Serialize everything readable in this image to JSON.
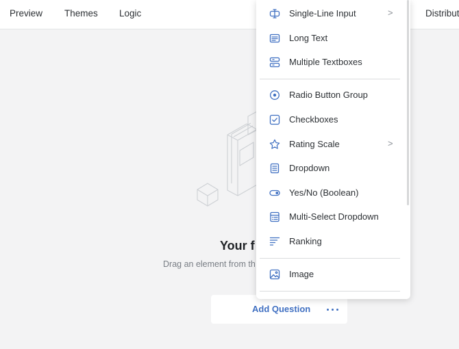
{
  "topbar": {
    "preview": "Preview",
    "themes": "Themes",
    "logic": "Logic",
    "distribute": "Distribut"
  },
  "empty": {
    "title": "Your f",
    "subtitle": "Drag an element from th"
  },
  "add_bar": {
    "add_label": "Add Question",
    "more_icon": "more-horizontal-icon"
  },
  "menu": {
    "accent_color": "#3f6fc1",
    "items": [
      {
        "label": "Single-Line Input",
        "icon": "single-line-input-icon",
        "submenu": ">"
      },
      {
        "label": "Long Text",
        "icon": "long-text-icon"
      },
      {
        "label": "Multiple Textboxes",
        "icon": "multiple-textboxes-icon"
      },
      {
        "label": "Radio Button Group",
        "icon": "radio-button-icon"
      },
      {
        "label": "Checkboxes",
        "icon": "checkbox-icon"
      },
      {
        "label": "Rating Scale",
        "icon": "star-icon",
        "submenu": ">"
      },
      {
        "label": "Dropdown",
        "icon": "dropdown-icon"
      },
      {
        "label": "Yes/No (Boolean)",
        "icon": "toggle-icon"
      },
      {
        "label": "Multi-Select Dropdown",
        "icon": "multi-select-icon"
      },
      {
        "label": "Ranking",
        "icon": "ranking-icon"
      },
      {
        "label": "Image",
        "icon": "image-icon"
      }
    ]
  }
}
